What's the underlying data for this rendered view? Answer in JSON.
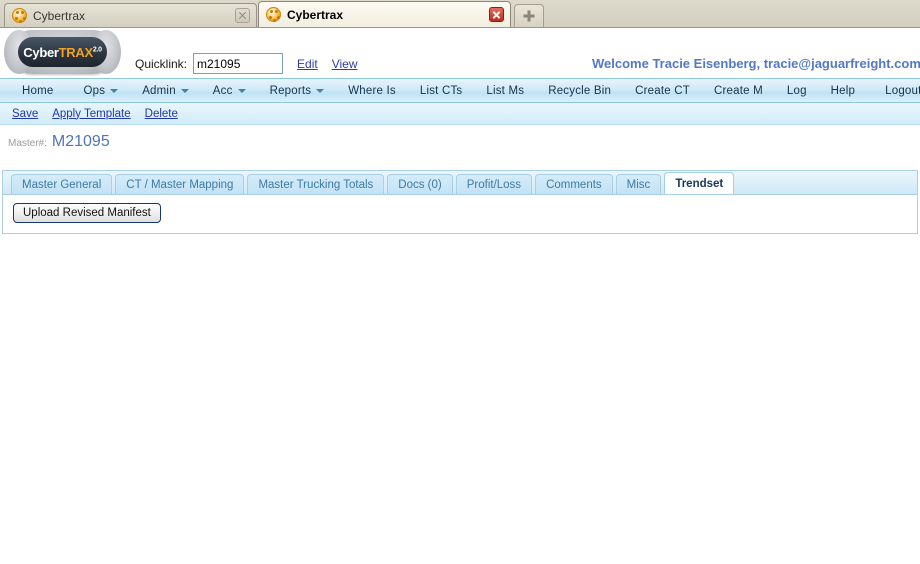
{
  "browser": {
    "tabs": [
      {
        "title": "Cybertrax",
        "active": false,
        "close_label": "x",
        "favicon": "cybertrax-favicon"
      },
      {
        "title": "Cybertrax",
        "active": true,
        "close_label": "x",
        "favicon": "cybertrax-favicon"
      }
    ],
    "new_tab_label": "+"
  },
  "header": {
    "logo": {
      "part1": "Cyber",
      "part2": "TRAX",
      "version": "2.0"
    },
    "quicklink": {
      "label": "Quicklink:",
      "value": "m21095",
      "placeholder": "",
      "edit_label": "Edit",
      "view_label": "View"
    },
    "welcome": "Welcome Tracie Eisenberg, tracie@jaguarfreight.com,"
  },
  "nav": {
    "items": [
      {
        "label": "Home",
        "caret": false
      },
      {
        "label": "Ops",
        "caret": true
      },
      {
        "label": "Admin",
        "caret": true
      },
      {
        "label": "Acc",
        "caret": true
      },
      {
        "label": "Reports",
        "caret": true
      },
      {
        "label": "Where Is",
        "caret": false
      },
      {
        "label": "List CTs",
        "caret": false
      },
      {
        "label": "List Ms",
        "caret": false
      },
      {
        "label": "Recycle Bin",
        "caret": false
      },
      {
        "label": "Create CT",
        "caret": false
      },
      {
        "label": "Create M",
        "caret": false
      },
      {
        "label": "Log",
        "caret": false
      },
      {
        "label": "Help",
        "caret": false
      },
      {
        "label": "Logout",
        "caret": false
      }
    ]
  },
  "actions": [
    {
      "label": "Save"
    },
    {
      "label": "Apply Template"
    },
    {
      "label": "Delete"
    }
  ],
  "record": {
    "label": "Master#:",
    "value": "M21095"
  },
  "tabs": [
    {
      "label": "Master General",
      "selected": false
    },
    {
      "label": "CT / Master Mapping",
      "selected": false
    },
    {
      "label": "Master Trucking Totals",
      "selected": false
    },
    {
      "label": "Docs (0)",
      "selected": false
    },
    {
      "label": "Profit/Loss",
      "selected": false
    },
    {
      "label": "Comments",
      "selected": false
    },
    {
      "label": "Misc",
      "selected": false
    },
    {
      "label": "Trendset",
      "selected": true
    }
  ],
  "panel": {
    "upload_button_label": "Upload Revised Manifest"
  },
  "colors": {
    "accent_blue": "#5577c8",
    "link_blue": "#2338a8",
    "nav_text": "#16334d",
    "tab_text": "#3d7ba5",
    "active_tab_text": "#17365d",
    "logo_orange": "#f0a21b",
    "master_value": "#4e74b8"
  }
}
